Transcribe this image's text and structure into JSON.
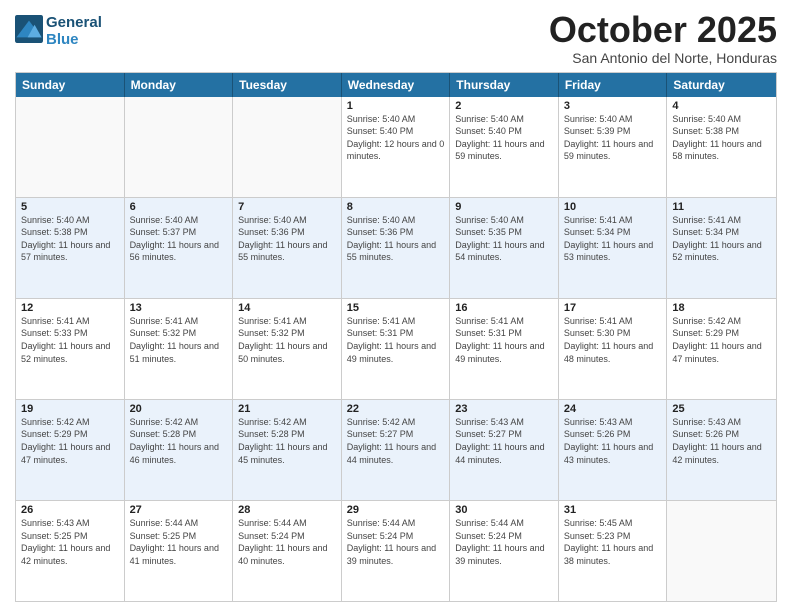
{
  "header": {
    "logo_line1": "General",
    "logo_line2": "Blue",
    "month": "October 2025",
    "location": "San Antonio del Norte, Honduras"
  },
  "days_of_week": [
    "Sunday",
    "Monday",
    "Tuesday",
    "Wednesday",
    "Thursday",
    "Friday",
    "Saturday"
  ],
  "rows": [
    [
      {
        "day": "",
        "empty": true
      },
      {
        "day": "",
        "empty": true
      },
      {
        "day": "",
        "empty": true
      },
      {
        "day": "1",
        "sunrise": "5:40 AM",
        "sunset": "5:40 PM",
        "daylight": "12 hours and 0 minutes."
      },
      {
        "day": "2",
        "sunrise": "5:40 AM",
        "sunset": "5:40 PM",
        "daylight": "11 hours and 59 minutes."
      },
      {
        "day": "3",
        "sunrise": "5:40 AM",
        "sunset": "5:39 PM",
        "daylight": "11 hours and 59 minutes."
      },
      {
        "day": "4",
        "sunrise": "5:40 AM",
        "sunset": "5:38 PM",
        "daylight": "11 hours and 58 minutes."
      }
    ],
    [
      {
        "day": "5",
        "sunrise": "5:40 AM",
        "sunset": "5:38 PM",
        "daylight": "11 hours and 57 minutes."
      },
      {
        "day": "6",
        "sunrise": "5:40 AM",
        "sunset": "5:37 PM",
        "daylight": "11 hours and 56 minutes."
      },
      {
        "day": "7",
        "sunrise": "5:40 AM",
        "sunset": "5:36 PM",
        "daylight": "11 hours and 55 minutes."
      },
      {
        "day": "8",
        "sunrise": "5:40 AM",
        "sunset": "5:36 PM",
        "daylight": "11 hours and 55 minutes."
      },
      {
        "day": "9",
        "sunrise": "5:40 AM",
        "sunset": "5:35 PM",
        "daylight": "11 hours and 54 minutes."
      },
      {
        "day": "10",
        "sunrise": "5:41 AM",
        "sunset": "5:34 PM",
        "daylight": "11 hours and 53 minutes."
      },
      {
        "day": "11",
        "sunrise": "5:41 AM",
        "sunset": "5:34 PM",
        "daylight": "11 hours and 52 minutes."
      }
    ],
    [
      {
        "day": "12",
        "sunrise": "5:41 AM",
        "sunset": "5:33 PM",
        "daylight": "11 hours and 52 minutes."
      },
      {
        "day": "13",
        "sunrise": "5:41 AM",
        "sunset": "5:32 PM",
        "daylight": "11 hours and 51 minutes."
      },
      {
        "day": "14",
        "sunrise": "5:41 AM",
        "sunset": "5:32 PM",
        "daylight": "11 hours and 50 minutes."
      },
      {
        "day": "15",
        "sunrise": "5:41 AM",
        "sunset": "5:31 PM",
        "daylight": "11 hours and 49 minutes."
      },
      {
        "day": "16",
        "sunrise": "5:41 AM",
        "sunset": "5:31 PM",
        "daylight": "11 hours and 49 minutes."
      },
      {
        "day": "17",
        "sunrise": "5:41 AM",
        "sunset": "5:30 PM",
        "daylight": "11 hours and 48 minutes."
      },
      {
        "day": "18",
        "sunrise": "5:42 AM",
        "sunset": "5:29 PM",
        "daylight": "11 hours and 47 minutes."
      }
    ],
    [
      {
        "day": "19",
        "sunrise": "5:42 AM",
        "sunset": "5:29 PM",
        "daylight": "11 hours and 47 minutes."
      },
      {
        "day": "20",
        "sunrise": "5:42 AM",
        "sunset": "5:28 PM",
        "daylight": "11 hours and 46 minutes."
      },
      {
        "day": "21",
        "sunrise": "5:42 AM",
        "sunset": "5:28 PM",
        "daylight": "11 hours and 45 minutes."
      },
      {
        "day": "22",
        "sunrise": "5:42 AM",
        "sunset": "5:27 PM",
        "daylight": "11 hours and 44 minutes."
      },
      {
        "day": "23",
        "sunrise": "5:43 AM",
        "sunset": "5:27 PM",
        "daylight": "11 hours and 44 minutes."
      },
      {
        "day": "24",
        "sunrise": "5:43 AM",
        "sunset": "5:26 PM",
        "daylight": "11 hours and 43 minutes."
      },
      {
        "day": "25",
        "sunrise": "5:43 AM",
        "sunset": "5:26 PM",
        "daylight": "11 hours and 42 minutes."
      }
    ],
    [
      {
        "day": "26",
        "sunrise": "5:43 AM",
        "sunset": "5:25 PM",
        "daylight": "11 hours and 42 minutes."
      },
      {
        "day": "27",
        "sunrise": "5:44 AM",
        "sunset": "5:25 PM",
        "daylight": "11 hours and 41 minutes."
      },
      {
        "day": "28",
        "sunrise": "5:44 AM",
        "sunset": "5:24 PM",
        "daylight": "11 hours and 40 minutes."
      },
      {
        "day": "29",
        "sunrise": "5:44 AM",
        "sunset": "5:24 PM",
        "daylight": "11 hours and 39 minutes."
      },
      {
        "day": "30",
        "sunrise": "5:44 AM",
        "sunset": "5:24 PM",
        "daylight": "11 hours and 39 minutes."
      },
      {
        "day": "31",
        "sunrise": "5:45 AM",
        "sunset": "5:23 PM",
        "daylight": "11 hours and 38 minutes."
      },
      {
        "day": "",
        "empty": true
      }
    ]
  ],
  "labels": {
    "sunrise": "Sunrise:",
    "sunset": "Sunset:",
    "daylight": "Daylight:"
  }
}
